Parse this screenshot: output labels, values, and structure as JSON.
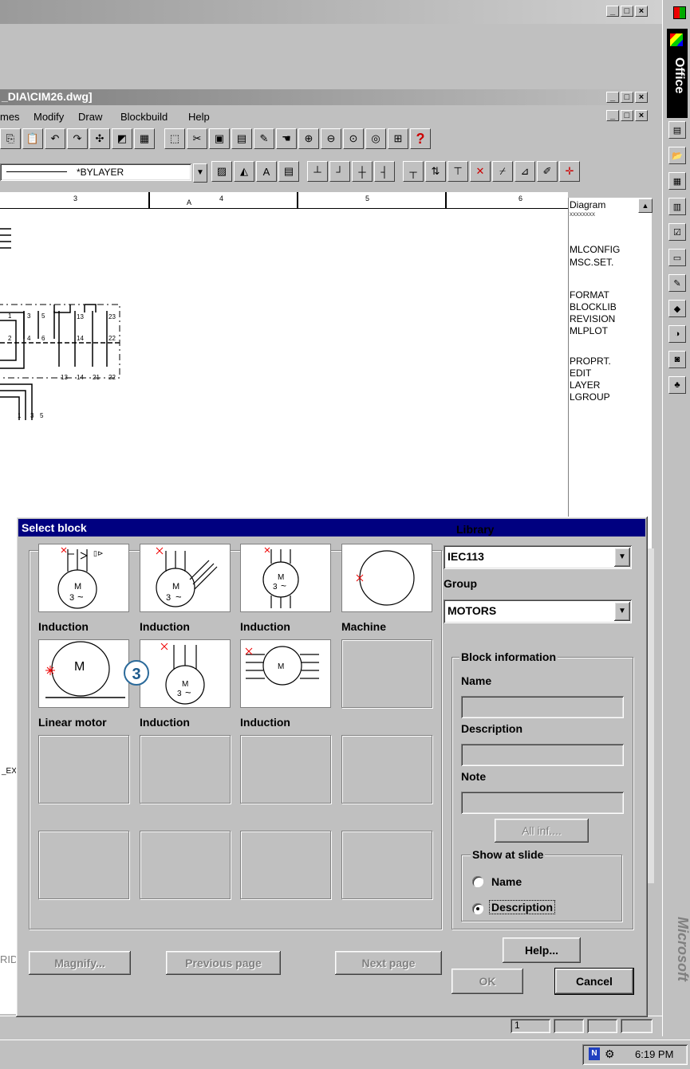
{
  "top_window": {
    "buttons": [
      "_",
      "□",
      "×"
    ]
  },
  "office_bar": {
    "label": "Office",
    "watermark": "Microsoft"
  },
  "doc_window": {
    "title": "_DIA\\CIM26.dwg]",
    "menu": [
      "mes",
      "Modify",
      "Draw",
      "Blockbuild",
      "Help"
    ],
    "layer_value": "*BYLAYER"
  },
  "side_panel": {
    "header": "Diagram",
    "subheader": "xxxxxxxx",
    "groups": [
      [
        "MLCONFIG",
        "MSC.SET."
      ],
      [
        "FORMAT",
        "BLOCKLIB",
        "REVISION",
        "MLPLOT"
      ],
      [
        "PROPRT.",
        "EDIT",
        "LAYER",
        "LGROUP"
      ]
    ]
  },
  "ruler": {
    "numbers": [
      "3",
      "4",
      "5",
      "6"
    ],
    "marker": "A"
  },
  "drawing_labels": {
    "contacts_top": [
      "1",
      "3",
      "5",
      "13",
      "23"
    ],
    "contacts_mid": [
      "2",
      "4",
      "6",
      "14",
      "22"
    ],
    "contacts_bot": [
      "13",
      "14",
      "21",
      "22"
    ],
    "bus_labels": [
      "1",
      "3",
      "5"
    ],
    "side_label": "_EX"
  },
  "dialog": {
    "title": "Select block",
    "library_label": "Library",
    "library_value": "IEC113",
    "group_label": "Group",
    "group_value": "MOTORS",
    "block_info": {
      "legend": "Block information",
      "name_label": "Name",
      "description_label": "Description",
      "note_label": "Note",
      "all_info_button": "All inf...."
    },
    "show_at_slide": {
      "legend": "Show at slide",
      "options": [
        "Name",
        "Description"
      ],
      "selected": "Description"
    },
    "blocks": [
      {
        "caption": "Induction"
      },
      {
        "caption": "Induction"
      },
      {
        "caption": "Induction"
      },
      {
        "caption": "Machine"
      },
      {
        "caption": "Linear motor"
      },
      {
        "caption": "Induction"
      },
      {
        "caption": "Induction"
      }
    ],
    "motor_symbol": {
      "letter": "M",
      "phase": "3",
      "wave": "~"
    },
    "callout": "3",
    "buttons": {
      "magnify": "Magnify...",
      "previous": "Previous page",
      "next": "Next page",
      "help": "Help...",
      "ok": "OK",
      "cancel": "Cancel"
    }
  },
  "status_bar": {
    "field_value": "1",
    "left_fragment": "RID"
  },
  "taskbar": {
    "time": "6:19 PM"
  }
}
